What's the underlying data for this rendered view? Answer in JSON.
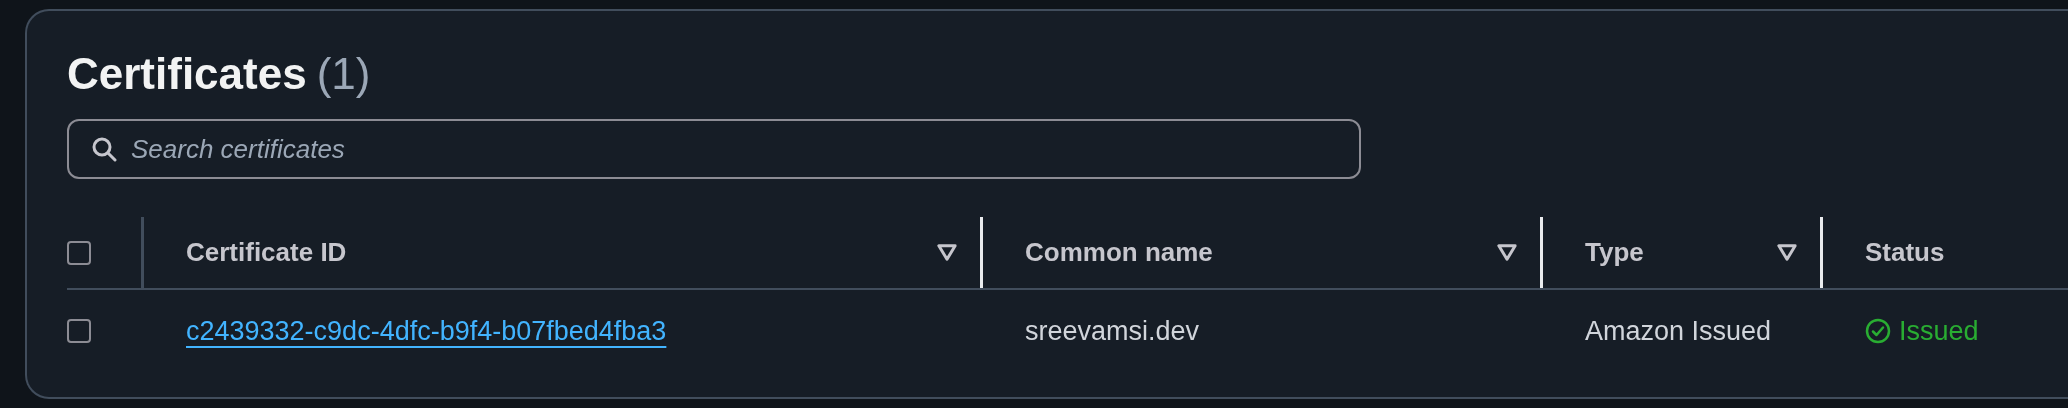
{
  "panel": {
    "title": "Certificates",
    "count": "(1)"
  },
  "search": {
    "placeholder": "Search certificates"
  },
  "table": {
    "select_all": {
      "checked": false
    },
    "columns": [
      {
        "label": "Certificate ID",
        "sortable": true
      },
      {
        "label": "Common name",
        "sortable": true
      },
      {
        "label": "Type",
        "sortable": true
      },
      {
        "label": "Status",
        "sortable": false
      }
    ],
    "rows": [
      {
        "checked": false,
        "certificate_id": "c2439332-c9dc-4dfc-b9f4-b07fbed4fba3",
        "common_name": "sreevamsi.dev",
        "type": "Amazon Issued",
        "status": {
          "kind": "success",
          "label": "Issued"
        }
      }
    ]
  }
}
